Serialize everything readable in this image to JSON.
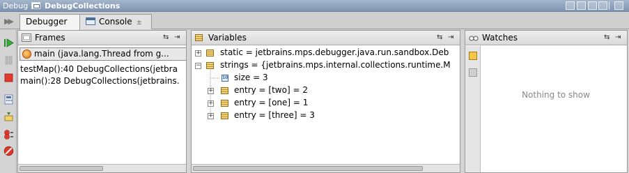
{
  "titlebar": {
    "label": "Debug",
    "name": "DebugCollections"
  },
  "tabs": [
    {
      "label": "Debugger",
      "active": true
    },
    {
      "label": "Console",
      "active": false
    }
  ],
  "toolbar": {
    "icons": [
      "resume-icon",
      "pause-icon",
      "stop-icon",
      "evaluate-icon",
      "step-icon",
      "breakpoints-icon",
      "mute-breakpoints-icon"
    ]
  },
  "frames": {
    "title": "Frames",
    "thread_selected": "main (java.lang.Thread from g...",
    "items": [
      "testMap():40 DebugCollections(jetbra",
      "main():28 DebugCollections(jetbrains."
    ]
  },
  "variables": {
    "title": "Variables",
    "rows": [
      "static = jetbrains.mps.debugger.java.run.sandbox.Deb",
      "strings = {jetbrains.mps.internal.collections.runtime.M",
      "size = 3",
      "entry = [two] = 2",
      "entry = [one] = 1",
      "entry = [three] = 3"
    ]
  },
  "watches": {
    "title": "Watches",
    "empty_text": "Nothing to show"
  },
  "colors": {
    "title_bar": "#7e94b0",
    "panel_header": "#d9d9d9",
    "empty_text": "#888888"
  }
}
